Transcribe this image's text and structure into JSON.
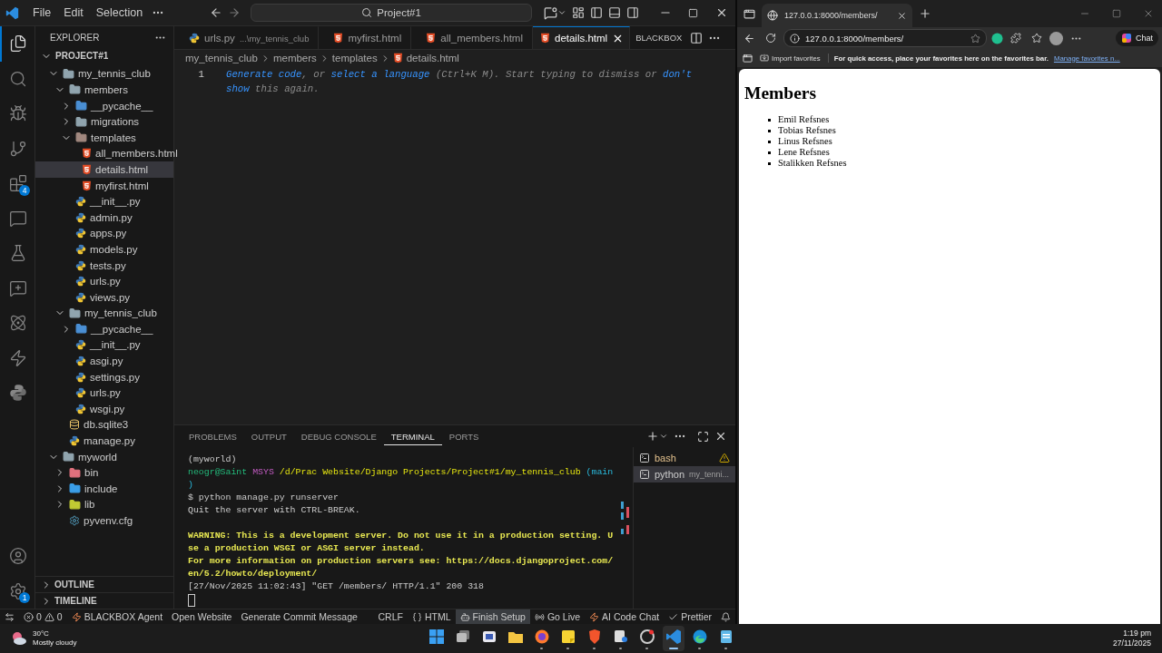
{
  "vscode": {
    "menu": [
      "File",
      "Edit",
      "Selection"
    ],
    "command_center": "Project#1",
    "activity_bar": [
      {
        "kind": "explorer",
        "selected": true
      },
      {
        "kind": "search",
        "selected": false
      },
      {
        "kind": "debug",
        "selected": false
      },
      {
        "kind": "scm",
        "selected": false
      },
      {
        "kind": "extensions",
        "selected": false,
        "badge": "4"
      },
      {
        "kind": "chat",
        "selected": false
      },
      {
        "kind": "testing",
        "selected": false
      },
      {
        "kind": "chat-plus",
        "selected": false
      },
      {
        "kind": "react",
        "selected": false
      },
      {
        "kind": "bolt",
        "selected": false
      },
      {
        "kind": "python",
        "selected": false
      }
    ],
    "activity_bottom": [
      {
        "kind": "account",
        "selected": false
      },
      {
        "kind": "settings",
        "selected": false,
        "badge": "1"
      }
    ],
    "explorer": {
      "title": "EXPLORER",
      "root": {
        "label": "PROJECT#1",
        "expanded": true
      },
      "tree": [
        {
          "label": "my_tennis_club",
          "kind": "folder",
          "expanded": true,
          "selected": false,
          "children": [
            {
              "label": "members",
              "kind": "folder",
              "expanded": true,
              "selected": false,
              "children": [
                {
                  "label": "__pycache__",
                  "kind": "folder-python",
                  "expanded": false,
                  "selected": false
                },
                {
                  "label": "migrations",
                  "kind": "folder",
                  "expanded": false,
                  "selected": false
                },
                {
                  "label": "templates",
                  "kind": "folder-templates",
                  "expanded": true,
                  "selected": false,
                  "children": [
                    {
                      "label": "all_members.html",
                      "kind": "html",
                      "selected": false
                    },
                    {
                      "label": "details.html",
                      "kind": "html",
                      "selected": true
                    },
                    {
                      "label": "myfirst.html",
                      "kind": "html",
                      "selected": false
                    }
                  ]
                },
                {
                  "label": "__init__.py",
                  "kind": "python",
                  "selected": false
                },
                {
                  "label": "admin.py",
                  "kind": "python",
                  "selected": false
                },
                {
                  "label": "apps.py",
                  "kind": "python",
                  "selected": false
                },
                {
                  "label": "models.py",
                  "kind": "python",
                  "selected": false
                },
                {
                  "label": "tests.py",
                  "kind": "python",
                  "selected": false
                },
                {
                  "label": "urls.py",
                  "kind": "python",
                  "selected": false
                },
                {
                  "label": "views.py",
                  "kind": "python",
                  "selected": false
                }
              ]
            },
            {
              "label": "my_tennis_club",
              "kind": "folder",
              "expanded": true,
              "selected": false,
              "children": [
                {
                  "label": "__pycache__",
                  "kind": "folder-python",
                  "expanded": false,
                  "selected": false
                },
                {
                  "label": "__init__.py",
                  "kind": "python",
                  "selected": false
                },
                {
                  "label": "asgi.py",
                  "kind": "python",
                  "selected": false
                },
                {
                  "label": "settings.py",
                  "kind": "python",
                  "selected": false
                },
                {
                  "label": "urls.py",
                  "kind": "python",
                  "selected": false
                },
                {
                  "label": "wsgi.py",
                  "kind": "python",
                  "selected": false
                }
              ]
            },
            {
              "label": "db.sqlite3",
              "kind": "database",
              "selected": false
            },
            {
              "label": "manage.py",
              "kind": "python",
              "selected": false
            }
          ]
        },
        {
          "label": "myworld",
          "kind": "folder",
          "expanded": true,
          "selected": false,
          "children": [
            {
              "label": "bin",
              "kind": "folder-bin",
              "expanded": false,
              "selected": false
            },
            {
              "label": "include",
              "kind": "folder-include",
              "expanded": false,
              "selected": false
            },
            {
              "label": "lib",
              "kind": "folder-lib",
              "expanded": false,
              "selected": false
            },
            {
              "label": "pyvenv.cfg",
              "kind": "config",
              "selected": false
            }
          ]
        }
      ],
      "sections": [
        {
          "label": "OUTLINE",
          "expanded": false
        },
        {
          "label": "TIMELINE",
          "expanded": false
        }
      ]
    },
    "tabs": [
      {
        "label": "urls.py",
        "description": "...\\my_tennis_club",
        "kind": "python",
        "selected": false
      },
      {
        "label": "myfirst.html",
        "kind": "html",
        "selected": false
      },
      {
        "label": "all_members.html",
        "kind": "html",
        "selected": false
      },
      {
        "label": "details.html",
        "kind": "html",
        "selected": true
      }
    ],
    "tab_action": "BLACKBOX",
    "breadcrumb": [
      {
        "label": "my_tennis_club",
        "kind": "folder"
      },
      {
        "label": "members",
        "kind": "folder"
      },
      {
        "label": "templates",
        "kind": "folder"
      },
      {
        "label": "details.html",
        "kind": "html"
      }
    ],
    "editor": {
      "line_number": "1",
      "hint_lines": [
        [
          {
            "text": "Generate code",
            "kind": "link"
          },
          {
            "text": ", or ",
            "kind": "plain"
          },
          {
            "text": "select a language",
            "kind": "link"
          },
          {
            "text": " (Ctrl+K M). Start typing to dismiss or ",
            "kind": "plain"
          },
          {
            "text": "don't",
            "kind": "link"
          }
        ],
        [
          {
            "text": "show",
            "kind": "link"
          },
          {
            "text": " this again.",
            "kind": "plain"
          }
        ]
      ]
    },
    "panel": {
      "tabs": [
        {
          "label": "PROBLEMS",
          "selected": false
        },
        {
          "label": "OUTPUT",
          "selected": false
        },
        {
          "label": "DEBUG CONSOLE",
          "selected": false
        },
        {
          "label": "TERMINAL",
          "selected": true
        },
        {
          "label": "PORTS",
          "selected": false
        }
      ],
      "terminal_lines": [
        {
          "segments": [
            {
              "text": "(myworld)",
              "kind": "plain"
            }
          ]
        },
        {
          "segments": [
            {
              "text": "neogr@Saint",
              "kind": "user"
            },
            {
              "text": "MSYS",
              "kind": "host"
            },
            {
              "text": "/d/Prac Website/Django Projects/Project#1/my_tennis_club",
              "kind": "path"
            },
            {
              "text": "(main",
              "kind": "branch"
            }
          ]
        },
        {
          "segments": [
            {
              "text": ")",
              "kind": "branch"
            }
          ]
        },
        {
          "segments": [
            {
              "text": "$ python manage.py runserver",
              "kind": "plain"
            }
          ]
        },
        {
          "segments": [
            {
              "text": "Quit the server with CTRL-BREAK.",
              "kind": "plain"
            }
          ]
        },
        {
          "gap_before": true,
          "segments": [
            {
              "text": "WARNING: This is a development server. Do not use it in a production setting. U",
              "kind": "warning"
            }
          ]
        },
        {
          "segments": [
            {
              "text": "se a production WSGI or ASGI server instead.",
              "kind": "warning"
            }
          ]
        },
        {
          "segments": [
            {
              "text": "For more information on production servers see: https://docs.djangoproject.com/",
              "kind": "warning"
            }
          ]
        },
        {
          "segments": [
            {
              "text": "en/5.2/howto/deployment/",
              "kind": "warning"
            }
          ]
        },
        {
          "segments": [
            {
              "text": "[27/Nov/2025 11:02:43] \"GET /members/ HTTP/1.1\" 200 318",
              "kind": "plain"
            }
          ]
        }
      ],
      "terminals": [
        {
          "label": "bash",
          "warning": true,
          "selected": false
        },
        {
          "label": "python",
          "description": "my_tenni...",
          "warning": false,
          "selected": true
        }
      ]
    },
    "status_bar": {
      "problems": {
        "errors": "0",
        "warnings": "0"
      },
      "left": [
        {
          "kind": "agent",
          "label": "BLACKBOX Agent"
        },
        {
          "kind": "plain",
          "label": "Open Website"
        },
        {
          "kind": "plain",
          "label": "Generate Commit Message"
        }
      ],
      "right": [
        {
          "kind": "plain",
          "label": "CRLF"
        },
        {
          "kind": "braces",
          "label": "HTML"
        },
        {
          "kind": "setup",
          "label": "Finish Setup"
        },
        {
          "kind": "live",
          "label": "Go Live"
        },
        {
          "kind": "agent",
          "label": "AI Code Chat"
        },
        {
          "kind": "check",
          "label": "Prettier"
        }
      ]
    }
  },
  "browser": {
    "tab_title": "127.0.0.1:8000/members/",
    "address": "127.0.0.1:8000/members/",
    "chat": "Chat",
    "favorites": {
      "import": "Import favorites",
      "hint": "For quick access, place your favorites here on the favorites bar.",
      "link": "Manage favorites n..."
    },
    "page": {
      "heading": "Members",
      "items": [
        "Emil Refsnes",
        "Tobias Refsnes",
        "Linus Refsnes",
        "Lene Refsnes",
        "Stalikken Refsnes"
      ]
    }
  },
  "taskbar": {
    "weather": {
      "temp": "30°C",
      "condition": "Mostly cloudy"
    },
    "apps": [
      {
        "kind": "start",
        "running": false,
        "selected": false
      },
      {
        "kind": "taskview",
        "running": false,
        "selected": false
      },
      {
        "kind": "mail",
        "running": false,
        "selected": false
      },
      {
        "kind": "files",
        "running": false,
        "selected": false
      },
      {
        "kind": "firefox",
        "running": true,
        "selected": false
      },
      {
        "kind": "notes",
        "running": true,
        "selected": false
      },
      {
        "kind": "brave",
        "running": true,
        "selected": false
      },
      {
        "kind": "snip",
        "running": true,
        "selected": false
      },
      {
        "kind": "chrome",
        "running": true,
        "selected": false
      },
      {
        "kind": "vscode",
        "running": true,
        "selected": true
      },
      {
        "kind": "edge",
        "running": true,
        "selected": false
      },
      {
        "kind": "notepad",
        "running": true,
        "selected": false
      }
    ],
    "time": "1:19 pm",
    "date": "27/11/2025"
  }
}
